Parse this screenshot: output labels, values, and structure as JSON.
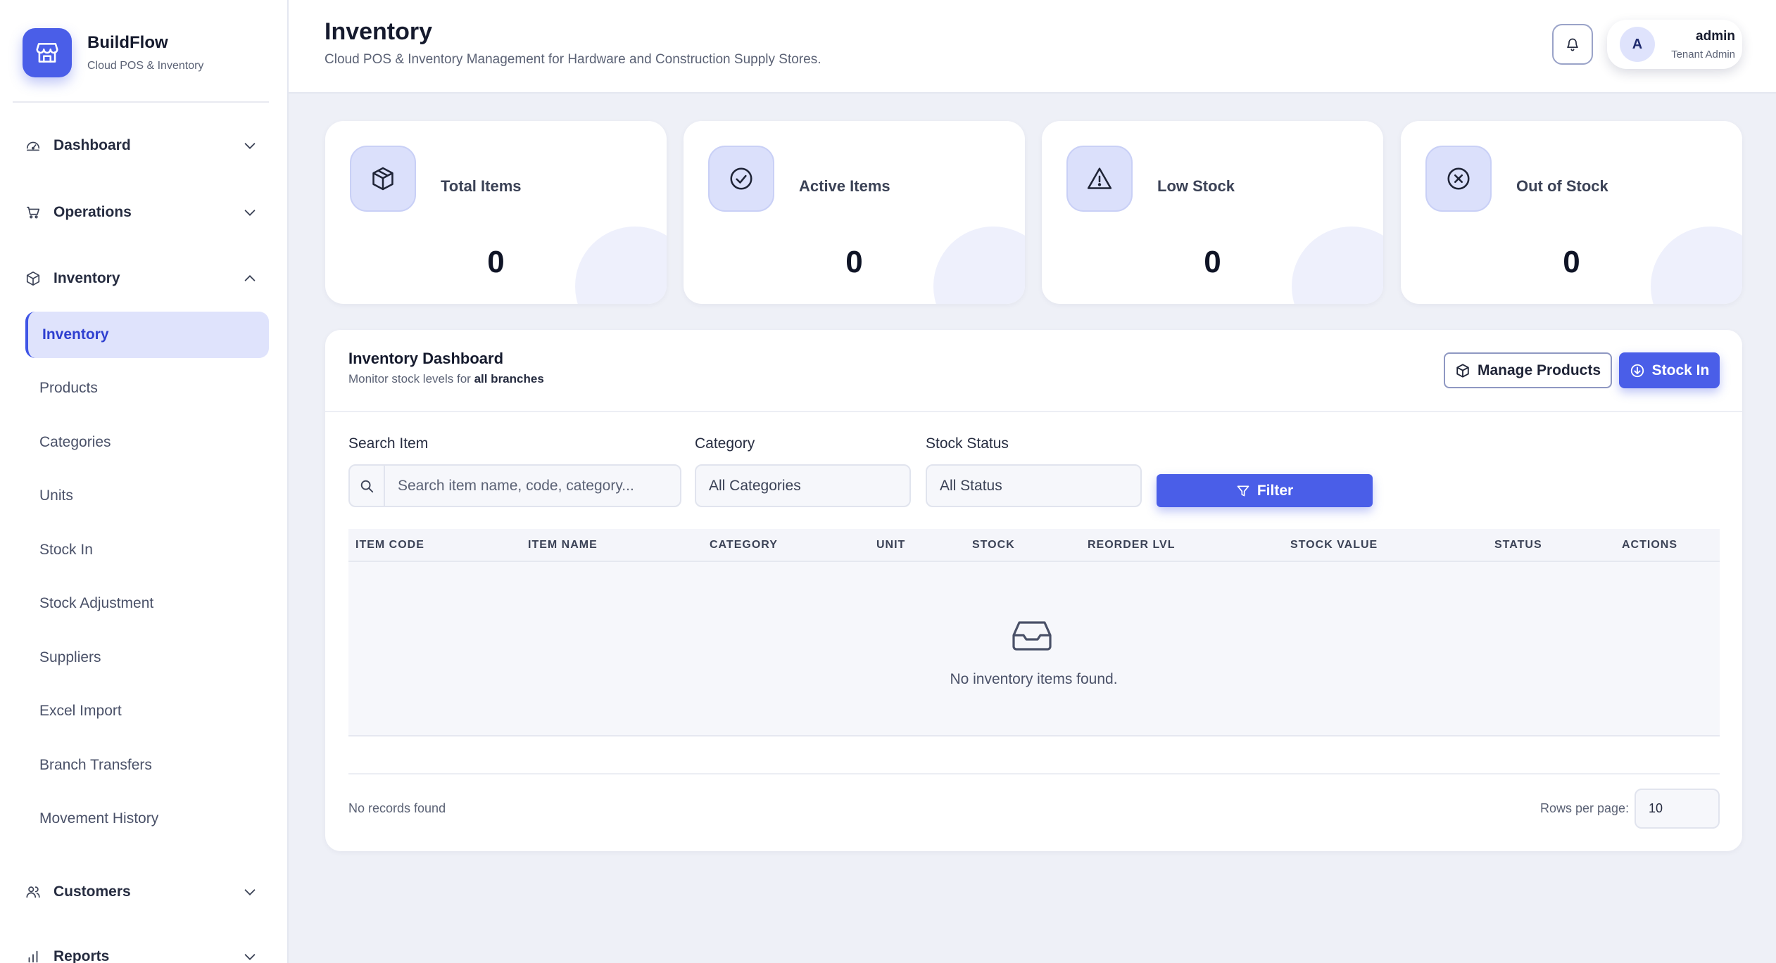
{
  "brand": {
    "name": "BuildFlow",
    "tagline": "Cloud POS & Inventory",
    "icon": "store-icon"
  },
  "sidebar": {
    "groups": [
      {
        "label": "Dashboard",
        "icon": "dashboard-icon",
        "expanded": false
      },
      {
        "label": "Operations",
        "icon": "cart-icon",
        "expanded": false
      },
      {
        "label": "Inventory",
        "icon": "box-icon",
        "expanded": true
      },
      {
        "label": "Customers",
        "icon": "users-icon",
        "expanded": false
      },
      {
        "label": "Reports",
        "icon": "bar-chart-icon",
        "expanded": false
      }
    ],
    "inventory_items": [
      {
        "label": "Inventory",
        "active": true
      },
      {
        "label": "Products"
      },
      {
        "label": "Categories"
      },
      {
        "label": "Units"
      },
      {
        "label": "Stock In"
      },
      {
        "label": "Stock Adjustment"
      },
      {
        "label": "Suppliers"
      },
      {
        "label": "Excel Import"
      },
      {
        "label": "Branch Transfers"
      },
      {
        "label": "Movement History"
      }
    ]
  },
  "header": {
    "title": "Inventory",
    "subtitle": "Cloud POS & Inventory Management for Hardware and Construction Supply Stores.",
    "user": {
      "initial": "A",
      "name": "admin",
      "role": "Tenant Admin"
    }
  },
  "stats": [
    {
      "label": "Total Items",
      "value": "0",
      "icon": "box-icon"
    },
    {
      "label": "Active Items",
      "value": "0",
      "icon": "check-circle-icon"
    },
    {
      "label": "Low Stock",
      "value": "0",
      "icon": "warning-icon"
    },
    {
      "label": "Out of Stock",
      "value": "0",
      "icon": "x-circle-icon"
    }
  ],
  "panel": {
    "title": "Inventory Dashboard",
    "subtitle_prefix": "Monitor stock levels for ",
    "subtitle_scope": "all branches",
    "manage_products_label": "Manage Products",
    "stock_in_label": "Stock In"
  },
  "filters": {
    "search_label": "Search Item",
    "search_placeholder": "Search item name, code, category...",
    "category_label": "Category",
    "category_value": "All Categories",
    "status_label": "Stock Status",
    "status_value": "All Status",
    "filter_button": "Filter"
  },
  "table": {
    "columns": [
      "ITEM CODE",
      "ITEM NAME",
      "CATEGORY",
      "UNIT",
      "STOCK",
      "REORDER LVL",
      "STOCK VALUE",
      "STATUS",
      "ACTIONS"
    ],
    "empty_message": "No inventory items found."
  },
  "footer": {
    "records_text": "No records found",
    "rows_per_page_label": "Rows per page:",
    "rows_per_page_value": "10"
  },
  "colors": {
    "accent": "#4a5ee8",
    "active_bg": "#dfe3fc",
    "page_bg": "#eef0f7"
  }
}
